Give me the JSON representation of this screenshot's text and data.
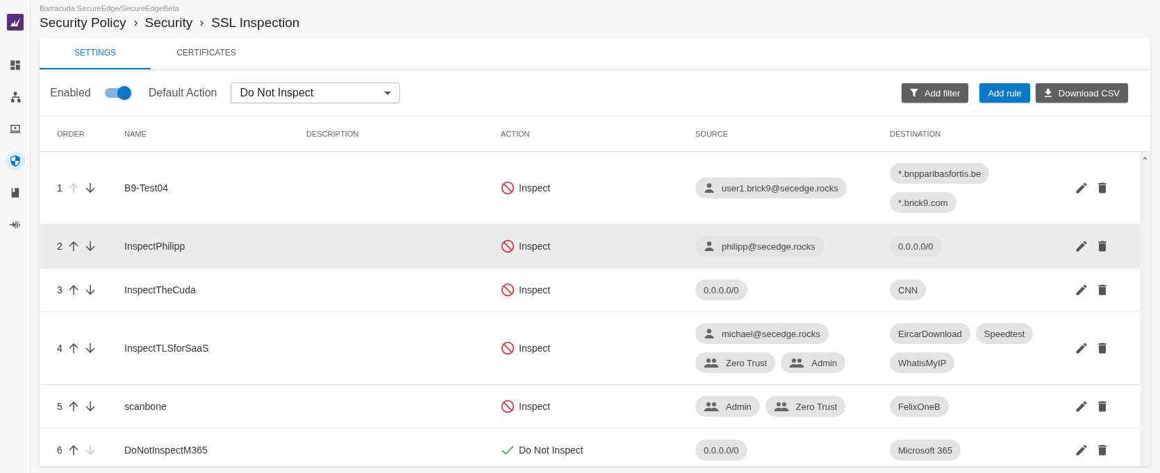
{
  "sidebar": {
    "items": [
      {
        "kind": "dashboard",
        "selected": false
      },
      {
        "kind": "network",
        "selected": false
      },
      {
        "kind": "device",
        "selected": false
      },
      {
        "kind": "security",
        "selected": true
      },
      {
        "kind": "book",
        "selected": false
      },
      {
        "kind": "gear",
        "selected": false
      }
    ]
  },
  "header": {
    "path": "Barracuda SecureEdge/SecureEdgeBeta",
    "breadcrumbs": [
      "Security Policy",
      "Security",
      "SSL Inspection"
    ]
  },
  "tabs": [
    {
      "label": "SETTINGS",
      "selected": true
    },
    {
      "label": "CERTIFICATES",
      "selected": false
    }
  ],
  "toolbar": {
    "enabled": {
      "label": "Enabled",
      "on": true
    },
    "default_action": {
      "label": "Default Action",
      "value": "Do Not Inspect"
    },
    "buttons": [
      {
        "label": "Add filter",
        "kind": "filter"
      },
      {
        "label": "Add rule",
        "kind": "primary"
      },
      {
        "label": "Download CSV",
        "kind": "download"
      }
    ]
  },
  "table": {
    "columns": [
      "ORDER",
      "NAME",
      "DESCRIPTION",
      "ACTION",
      "SOURCE",
      "DESTINATION"
    ],
    "rows": [
      {
        "order": "1",
        "up_disabled": true,
        "down_disabled": false,
        "selected": false,
        "name": "B9-Test04",
        "action": {
          "kind": "inspect",
          "label": "Inspect"
        },
        "source": [
          {
            "kind": "user",
            "label": "user1.brick9@secedge.rocks"
          }
        ],
        "destination": [
          "*.bnpparibasfortis.be",
          "*.brick9.com"
        ]
      },
      {
        "order": "2",
        "up_disabled": false,
        "down_disabled": false,
        "selected": true,
        "name": "InspectPhilipp",
        "action": {
          "kind": "inspect",
          "label": "Inspect"
        },
        "source": [
          {
            "kind": "user",
            "label": "philipp@secedge.rocks"
          }
        ],
        "destination": [
          "0.0.0.0/0"
        ]
      },
      {
        "order": "3",
        "up_disabled": false,
        "down_disabled": false,
        "selected": false,
        "name": "InspectTheCuda",
        "action": {
          "kind": "inspect",
          "label": "Inspect"
        },
        "source": [
          {
            "kind": "plain",
            "label": "0.0.0.0/0"
          }
        ],
        "destination": [
          "CNN"
        ]
      },
      {
        "order": "4",
        "up_disabled": false,
        "down_disabled": false,
        "selected": false,
        "name": "InspectTLSforSaaS",
        "action": {
          "kind": "inspect",
          "label": "Inspect"
        },
        "source": [
          {
            "kind": "user",
            "label": "michael@secedge.rocks"
          },
          {
            "kind": "group",
            "label": "Zero Trust"
          },
          {
            "kind": "group",
            "label": "Admin"
          }
        ],
        "destination": [
          "EircarDownload",
          "Speedtest",
          "WhatisMyIP"
        ]
      },
      {
        "order": "5",
        "up_disabled": false,
        "down_disabled": false,
        "selected": false,
        "name": "scanbone",
        "action": {
          "kind": "inspect",
          "label": "Inspect"
        },
        "source": [
          {
            "kind": "group",
            "label": "Admin"
          },
          {
            "kind": "group",
            "label": "Zero Trust"
          }
        ],
        "destination": [
          "FelixOneB"
        ]
      },
      {
        "order": "6",
        "up_disabled": false,
        "down_disabled": true,
        "selected": false,
        "name": "DoNotInspectM365",
        "action": {
          "kind": "no_inspect",
          "label": "Do Not Inspect"
        },
        "source": [
          {
            "kind": "plain",
            "label": "0.0.0.0/0"
          }
        ],
        "destination": [
          "Microsoft 365"
        ]
      }
    ]
  }
}
